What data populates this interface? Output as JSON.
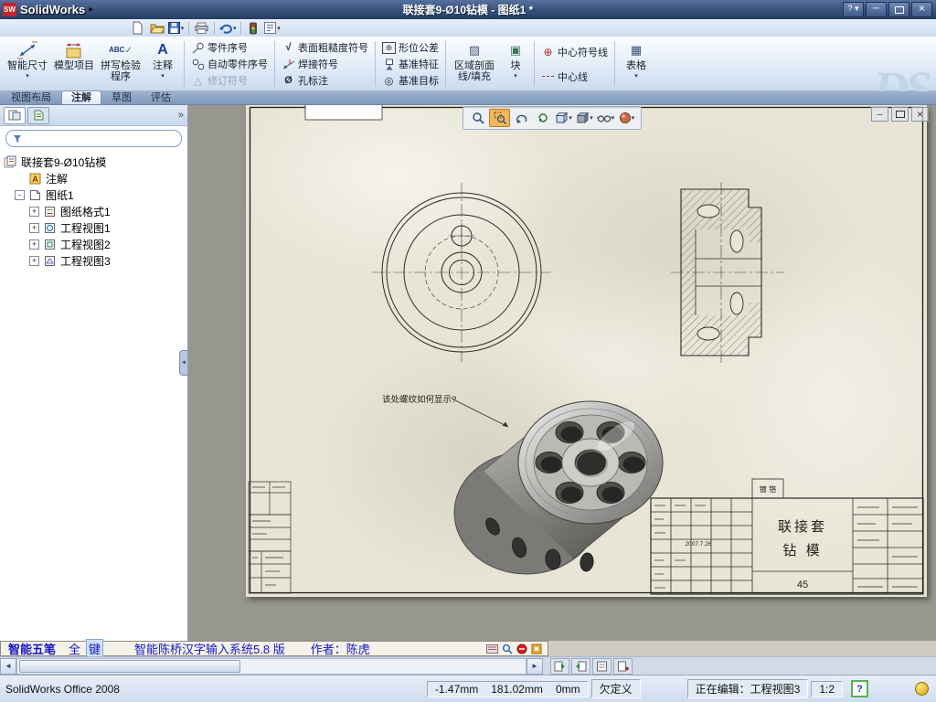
{
  "titlebar": {
    "app_name": "SolidWorks",
    "doc_title": "联接套9-Ø10钻模 - 图纸1 *"
  },
  "ribbon": {
    "watermark": "DS",
    "tabs": [
      {
        "label": "视图布局"
      },
      {
        "label": "注解"
      },
      {
        "label": "草图"
      },
      {
        "label": "评估"
      }
    ],
    "buttons": {
      "smart_dimension": "智能尺寸",
      "model_items": "模型项目",
      "spell_checker": "拼写检验程序",
      "abc": "ABC",
      "note": "注释",
      "note_letter": "A",
      "balloon": "零件序号",
      "auto_balloon": "自动零件序号",
      "revision_symbol": "修订符号",
      "surface_finish": "表面粗糙度符号",
      "weld_symbol": "焊接符号",
      "hole_callout": "孔标注",
      "geometric_tolerance": "形位公差",
      "datum_feature": "基准特征",
      "datum_target": "基准目标",
      "area_hatch": "区域剖面线/填充",
      "block": "块",
      "center_mark": "中心符号线",
      "centerline": "中心线",
      "tables": "表格"
    }
  },
  "feature_tree": {
    "root": "联接套9-Ø10钻模",
    "annotations": "注解",
    "sheet": "图纸1",
    "children": [
      {
        "label": "图纸格式1"
      },
      {
        "label": "工程视图1"
      },
      {
        "label": "工程视图2"
      },
      {
        "label": "工程视图3"
      }
    ]
  },
  "drawing": {
    "annotation": "该处螺纹如何显示?",
    "title_block": {
      "finish": "镀 铬",
      "name_line1": "联接套",
      "name_line2": "钻 模",
      "material": "45",
      "date": "2007.7.26"
    }
  },
  "ime_bar": {
    "name": "智能五笔",
    "mode_full": "全",
    "mode_key": "键",
    "system": "智能陈桥汉字输入系统5.8 版",
    "author": "作者：陈虎"
  },
  "status_bar": {
    "product": "SolidWorks Office 2008",
    "coord_x": "-1.47mm",
    "coord_y": "181.02mm",
    "coord_z": "0mm",
    "constraint_state": "欠定义",
    "editing": "正在编辑：工程视图3",
    "scale": "1:2",
    "help": "?"
  }
}
